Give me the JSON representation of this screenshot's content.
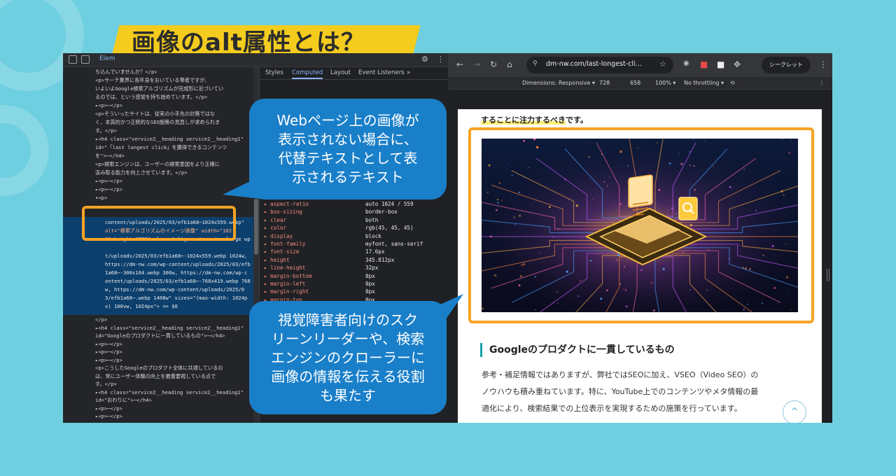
{
  "title": "画像のalt属性とは？",
  "devtools": {
    "tab_elements": "Elem",
    "sub_tabs": [
      "Styles",
      "Computed",
      "Layout",
      "Event Listeners"
    ],
    "sub_tabs_more": "»",
    "html_lines": [
      "ち込んでいませんか？</p>",
      "<p>サーチ業界に長年身をおいている筆者ですが、",
      "いよいよGoogle検索アルゴリズムが完成形に近づいてい",
      "るのでは、という感覚を持ち始めています。</p>",
      "▸<p>⋯</p>",
      "<p>そういったサイトは、従来の小手先の対策ではな",
      "く、本質的かつ正統的なSEO施策の見直しが求められま",
      "す。</p>",
      "▸<h4 class=\"service2__heading service2__heading1\"",
      "id=\"「last longest click」を獲得できるコンテンツ",
      "を\">⋯</h4>",
      "<p>検索エンジンは、ユーザーの検索意図をより正確に",
      "汲み取る能力を向上させています。</p>",
      "▸<p>⋯</p>",
      "▸<p>⋯</p>",
      "▾<p>"
    ],
    "selected_lines": [
      "content/uploads/2025/03/efb1a68⋯1024x559.webp\"",
      "alt=\"検索アルゴリズムのイメージ画像\" width=\"102",
      "4\" height=\"559\" class=\"aligncenter size-large wp",
      "",
      "t/uploads/2025/03/efb1a68⋯-1024x559.webp 1024w,",
      "https://dm-nw.com/wp-content/uploads/2025/03/efb",
      "1a68⋯-300x164.webp 300w, https://dm-nw.com/wp-c",
      "ontent/uploads/2025/03/efb1a68⋯-768x419.webp 768",
      "w, https://dm-nw.com/wp-content/uploads/2025/0",
      "3/efb1a68⋯.webp 1408w\" sizes=\"(max-width: 1024p",
      "x) 100vw, 1024px\"> == $0"
    ],
    "after_lines": [
      "</p>",
      "▸<h4 class=\"service2__heading service2__heading1\"",
      "id=\"Googleのプロダクトに一貫しているもの\">⋯</h4>",
      "▸<p>⋯</p>",
      "▸<p>⋯</p>",
      "▸<p>⋯</p>",
      "<p>こうしたGoogleのプロダクト全体に共通しているの",
      "は、常にユーザー体験の向上を最重要視している点で",
      "す。</p>",
      "▸<h4 class=\"service2__heading service2__heading1\"",
      "id=\"おわりに\">⋯</h4>",
      "▸<p>⋯</p>",
      "▸<p>⋯</p>"
    ],
    "computed": [
      {
        "name": "aspect-ratio",
        "value": "auto 1024 / 559"
      },
      {
        "name": "box-sizing",
        "value": "border-box"
      },
      {
        "name": "clear",
        "value": "both"
      },
      {
        "name": "color",
        "value": "rgb(45, 45, 45)"
      },
      {
        "name": "display",
        "value": "block"
      },
      {
        "name": "font-family",
        "value": "myfont, sans-serif"
      },
      {
        "name": "font-size",
        "value": "17.6px"
      },
      {
        "name": "height",
        "value": "345.812px"
      },
      {
        "name": "line-height",
        "value": "32px"
      },
      {
        "name": "margin-bottom",
        "value": "0px"
      },
      {
        "name": "margin-left",
        "value": "0px"
      },
      {
        "name": "margin-right",
        "value": "0px"
      },
      {
        "name": "margin-top",
        "value": "0px"
      }
    ]
  },
  "browser": {
    "url": "dm-nw.com/last-longest-cli...",
    "incognito_label": "シークレット",
    "dimensions_label": "Dimensions: Responsive ▾",
    "width_value": "728",
    "height_value": "658",
    "zoom": "100% ▾",
    "throttle": "No throttling ▾"
  },
  "page": {
    "lead_highlight": "することに注力するべき",
    "lead_tail": "です。",
    "heading": "Googleのプロダクトに一貫しているもの",
    "para_lines": [
      "参考・補足情報ではありますが、弊社ではSEOに加え、VSEO（Video SEO）の",
      "ノウハウも積み重ねています。特に、YouTube上でのコンテンツやメタ情報の最",
      "適化により、検索結果での上位表示を実現するための施策を行っています。"
    ],
    "scroll_top": "^"
  },
  "callouts": {
    "top": "Webページ上の画像が\n表示されない場合に、\n代替テキストとして表\n示されるテキスト",
    "bottom": "視覚障害者向けのスク\nリーンリーダーや、検索\nエンジンのクローラーに\n画像の情報を伝える役割\nも果たす"
  },
  "colors": {
    "background": "#6ecfe0",
    "title_banner": "#f4cc1e",
    "callout": "#1a7fc9",
    "highlight_box": "#f7a325"
  }
}
